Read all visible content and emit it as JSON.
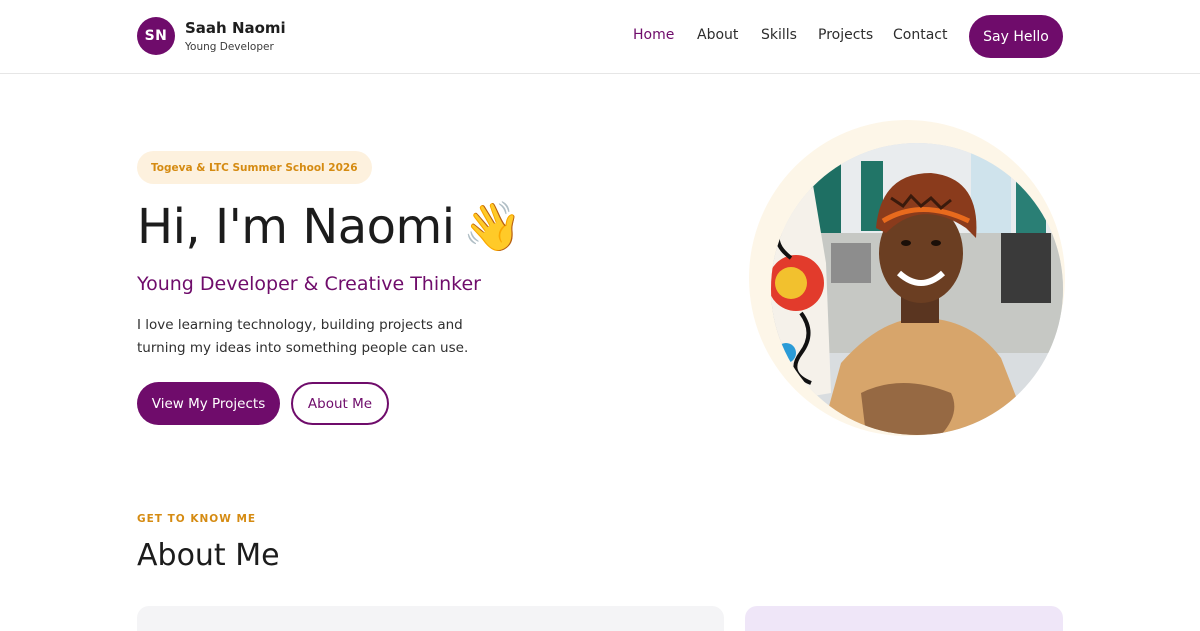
{
  "header": {
    "avatar_initials": "SN",
    "name": "Saah Naomi",
    "role": "Young Developer",
    "nav": [
      {
        "label": "Home",
        "active": true
      },
      {
        "label": "About",
        "active": false
      },
      {
        "label": "Skills",
        "active": false
      },
      {
        "label": "Projects",
        "active": false
      },
      {
        "label": "Contact",
        "active": false
      }
    ],
    "cta_label": "Say Hello"
  },
  "hero": {
    "badge": "Togeva & LTC Summer School 2026",
    "title": "Hi, I'm Naomi",
    "title_emoji": "👋",
    "subtitle": "Young Developer & Creative Thinker",
    "description": "I love learning technology, building projects and turning my ideas into something people can use.",
    "primary_button": "View My Projects",
    "secondary_button": "About Me"
  },
  "about": {
    "eyebrow": "GET TO KNOW ME",
    "title": "About Me"
  },
  "colors": {
    "brand": "#6f0c6b",
    "accent": "#d58b12",
    "badge_bg": "#fdf1de",
    "card_left_bg": "#f4f4f6",
    "card_right_bg": "#efe6f8"
  }
}
